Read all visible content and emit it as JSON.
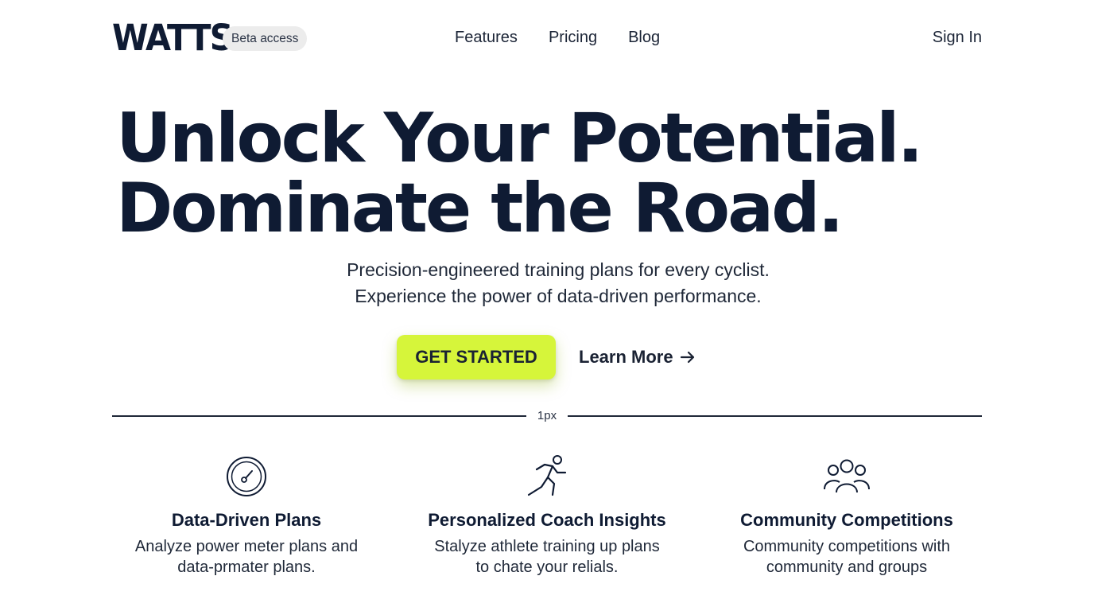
{
  "header": {
    "logo": "WATTS",
    "badge": "Beta access",
    "nav": [
      "Features",
      "Pricing",
      "Blog"
    ],
    "sign_in": "Sign In"
  },
  "hero": {
    "title_line1": "Unlock Your Potential.",
    "title_line2": "Dominate the Road.",
    "subtitle_line1": "Precision-engineered training plans for every cyclist.",
    "subtitle_line2": "Experience the power of data-driven performance.",
    "cta_label": "GET STARTED",
    "learn_more_label": "Learn More",
    "learn_more_icon": "arrow-right-icon"
  },
  "divider": {
    "label": "1px"
  },
  "features": [
    {
      "icon": "speedometer-icon",
      "title": "Data-Driven Plans",
      "line1": "Analyze power meter plans and",
      "line2": "data-prmater plans."
    },
    {
      "icon": "running-person-icon",
      "title": "Personalized Coach Insights",
      "line1": "Stalyze athlete training up plans",
      "line2": "to chate your relials."
    },
    {
      "icon": "group-icon",
      "title": "Community Competitions",
      "line1": "Community competitions with",
      "line2": "community and groups"
    }
  ],
  "colors": {
    "brand_navy": "#0f1b33",
    "accent_lime": "#d6f53a",
    "badge_bg": "#ececec"
  }
}
